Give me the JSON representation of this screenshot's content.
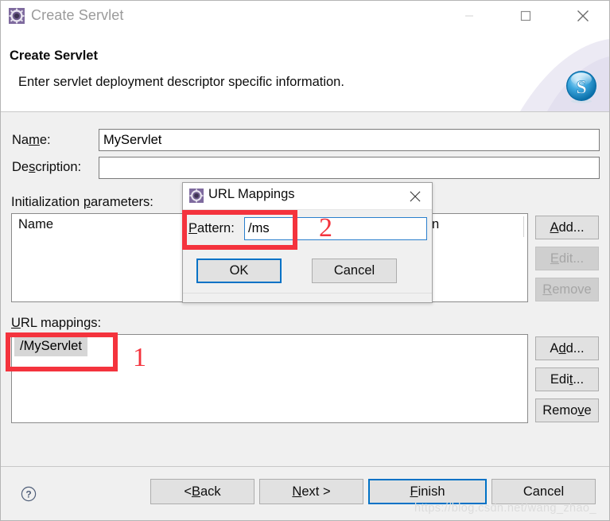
{
  "window": {
    "titlebar": {
      "title": "Create Servlet",
      "icon": "gear-icon",
      "minimize_label": "Minimize",
      "maximize_label": "Maximize",
      "close_label": "Close"
    },
    "header": {
      "title": "Create Servlet",
      "description": "Enter servlet deployment descriptor specific information.",
      "logo": "servlet-s-logo"
    }
  },
  "form": {
    "name": {
      "label_pre": "Na",
      "label_mnemonic": "m",
      "label_post": "e:",
      "value": "MyServlet"
    },
    "description": {
      "label_pre": "De",
      "label_mnemonic": "s",
      "label_post": "cription:",
      "value": ""
    }
  },
  "init_parameters": {
    "label_pre": "Initialization ",
    "label_mnemonic": "p",
    "label_post": "arameters:",
    "columns": [
      "Name",
      "n"
    ],
    "rows": []
  },
  "url_mappings": {
    "label_mnemonic": "U",
    "label_post": "RL mappings:",
    "rows": [
      "/MyServlet"
    ],
    "selected_index": 0
  },
  "side_buttons": {
    "init_params": [
      {
        "name": "add",
        "pre": "",
        "mnemonic": "A",
        "post": "dd...",
        "enabled": true
      },
      {
        "name": "edit",
        "pre": "",
        "mnemonic": "E",
        "post": "dit...",
        "enabled": false
      },
      {
        "name": "remove",
        "pre": "",
        "mnemonic": "R",
        "post": "emove",
        "enabled": false
      }
    ],
    "url_mappings": [
      {
        "name": "add",
        "pre": "A",
        "mnemonic": "d",
        "post": "d...",
        "enabled": true
      },
      {
        "name": "edit",
        "pre": "Edi",
        "mnemonic": "t",
        "post": "...",
        "enabled": true
      },
      {
        "name": "remove",
        "pre": "Remo",
        "mnemonic": "v",
        "post": "e",
        "enabled": true
      }
    ]
  },
  "footer": {
    "help_icon": "question-mark-icon",
    "buttons": [
      {
        "name": "back",
        "pre": "< ",
        "mnemonic": "B",
        "post": "ack",
        "default": false
      },
      {
        "name": "next",
        "pre": "",
        "mnemonic": "N",
        "post": "ext >",
        "default": false
      },
      {
        "name": "finish",
        "pre": "",
        "mnemonic": "F",
        "post": "inish",
        "default": true
      },
      {
        "name": "cancel",
        "pre": "Cancel",
        "mnemonic": "",
        "post": "",
        "default": false
      }
    ]
  },
  "watermark": "https://blog.csdn.net/wang_zhao_",
  "modal": {
    "title": "URL Mappings",
    "icon": "gear-icon",
    "close_label": "Close",
    "pattern": {
      "label_mnemonic": "P",
      "label_post": "attern:",
      "value": "/ms"
    },
    "buttons": [
      {
        "name": "ok",
        "label": "OK",
        "default": true
      },
      {
        "name": "cancel",
        "label": "Cancel",
        "default": false
      }
    ]
  },
  "annotations": [
    {
      "name": "annotation-1",
      "text": "1",
      "target": "url-mapping-row"
    },
    {
      "name": "annotation-2",
      "text": "2",
      "target": "pattern-field"
    }
  ],
  "colors": {
    "accent_blue": "#0072c6",
    "annotation_red": "#f4333d",
    "window_body": "#f0f0f0",
    "title_text": "#9b9b9b"
  }
}
